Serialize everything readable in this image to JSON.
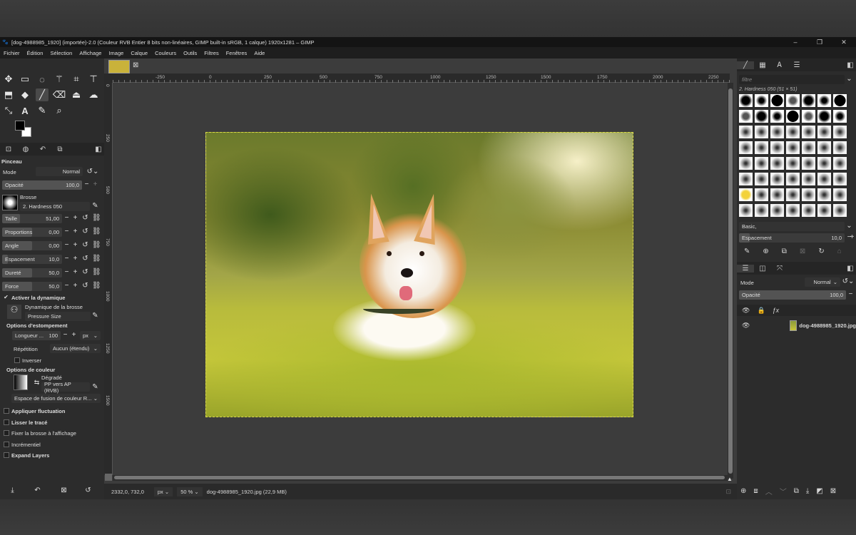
{
  "window": {
    "title": "[dog-4988985_1920] (importée)-2.0 (Couleur RVB Entier 8 bits non-linéaires, GIMP built-in sRGB, 1 calque) 1920x1281 – GIMP",
    "minimize": "–",
    "maximize": "❐",
    "close": "✕"
  },
  "menu": [
    "Fichier",
    "Édition",
    "Sélection",
    "Affichage",
    "Image",
    "Calque",
    "Couleurs",
    "Outils",
    "Filtres",
    "Fenêtres",
    "Aide"
  ],
  "tool_options": {
    "title": "Pinceau",
    "mode_label": "Mode",
    "mode_value": "Normal",
    "opacity_label": "Opacité",
    "opacity_value": "100,0",
    "brush_label": "Brosse",
    "brush_value": "2. Hardness 050",
    "params": [
      {
        "label": "Taille",
        "value": "51,00",
        "fill": 0.3
      },
      {
        "label": "Proportions",
        "value": "0,00",
        "fill": 0.5
      },
      {
        "label": "Angle",
        "value": "0,00",
        "fill": 0.5
      },
      {
        "label": "Espacement",
        "value": "10,0",
        "fill": 0.1
      },
      {
        "label": "Dureté",
        "value": "50,0",
        "fill": 0.5
      },
      {
        "label": "Force",
        "value": "50,0",
        "fill": 0.5
      }
    ],
    "dynamics_toggle": "Activer la dynamique",
    "dynamics_label": "Dynamique de la brosse",
    "dynamics_value": "Pressure Size",
    "fade_title": "Options d'estompement",
    "fade_length_label": "Longueur ...",
    "fade_length_value": "100",
    "fade_unit": "px",
    "repeat_label": "Répétition",
    "repeat_value": "Aucun (étendu)",
    "invert_label": "Inverser",
    "color_title": "Options de couleur",
    "gradient_label": "Dégradé",
    "gradient_value": "PP vers AP (RVB)",
    "blend_space": "Espace de fusion de couleur R...",
    "apply_jitter": "Appliquer fluctuation",
    "smooth": "Lisser le tracé",
    "lock_brush": "Fixer la brosse à l'affichage",
    "incremental": "Incrémentiel",
    "expand_layers": "Expand Layers"
  },
  "canvas": {
    "ruler_labels": [
      "-250",
      "0",
      "250",
      "500",
      "750",
      "1000",
      "1250",
      "1500",
      "1750",
      "2000",
      "2250"
    ],
    "vruler_labels": [
      "0",
      "250",
      "500",
      "750",
      "1000",
      "1250",
      "1500"
    ],
    "status_coords": "2332,0, 732,0",
    "status_unit": "px",
    "status_zoom": "50 %",
    "status_file": "dog-4988985_1920.jpg (22,9 MB)"
  },
  "brushes": {
    "filter_placeholder": "filtre",
    "selected": "2. Hardness 050 (51 × 51)",
    "tag": "Basic,",
    "spacing_label": "Espacement",
    "spacing_value": "10,0"
  },
  "layers": {
    "mode_label": "Mode",
    "mode_value": "Normal",
    "opacity_label": "Opacité",
    "opacity_value": "100,0",
    "layer_name": "dog-4988985_1920.jpg"
  }
}
